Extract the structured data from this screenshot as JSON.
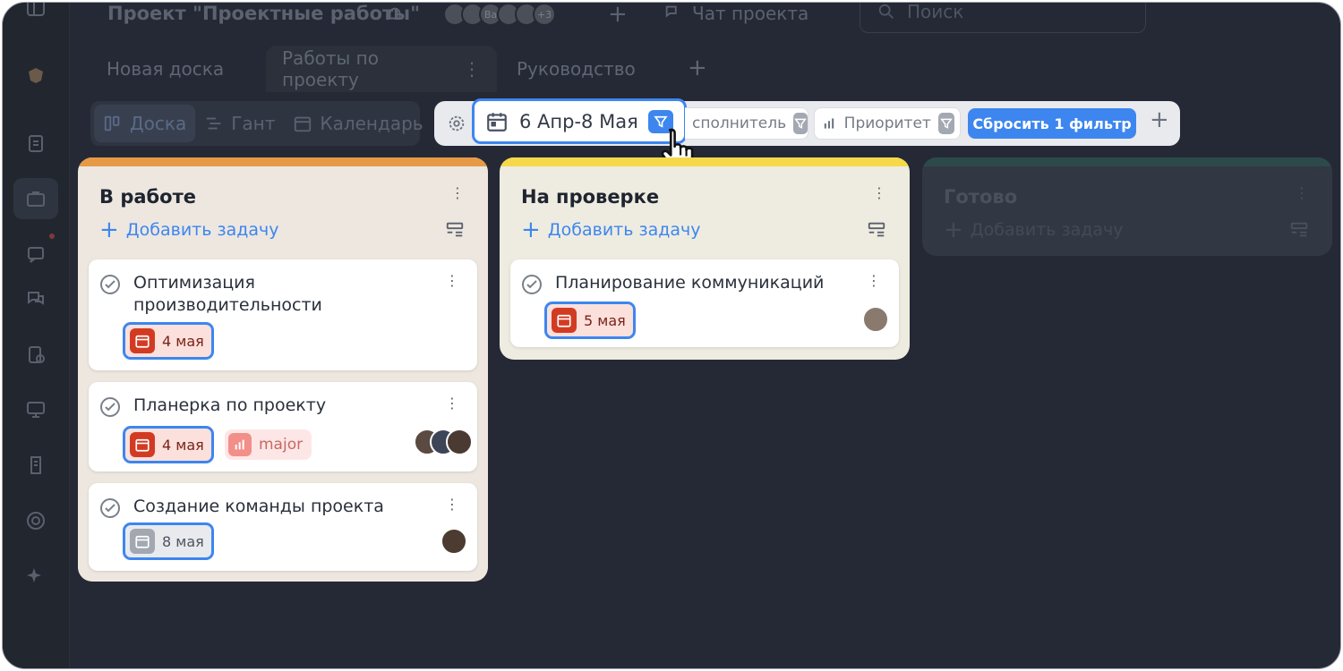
{
  "header": {
    "project_title": "Проект \"Проектные работы\"",
    "avatars_more": "+3",
    "avatar_initials": "Ва",
    "chat_label": "Чат проекта",
    "search_placeholder": "Поиск"
  },
  "tabs": [
    {
      "label": "Новая доска"
    },
    {
      "label": "Работы по проекту"
    },
    {
      "label": "Руководство"
    }
  ],
  "views": [
    {
      "label": "Доска",
      "icon": "board-icon"
    },
    {
      "label": "Гант",
      "icon": "gantt-icon"
    },
    {
      "label": "Календарь",
      "icon": "calendar-icon"
    }
  ],
  "filters": {
    "date_range": "6 Апр-8 Мая",
    "assignee_label": "сполнитель",
    "priority_label": "Приоритет",
    "reset_label": "Сбросить 1 фильтр"
  },
  "columns": [
    {
      "title": "В работе",
      "accent": "#e79a46",
      "bg": "#ede7e0",
      "add_label": "Добавить задачу",
      "cards": [
        {
          "title": "Оптимизация производительности",
          "due": "4 мая"
        },
        {
          "title": "Планерка по проекту",
          "due": "4 мая",
          "priority": "major"
        },
        {
          "title": "Создание команды проекта",
          "due": "8 мая"
        }
      ]
    },
    {
      "title": "На проверке",
      "accent": "#f6d94a",
      "bg": "#eeece0",
      "add_label": "Добавить задачу",
      "cards": [
        {
          "title": "Планирование коммуникаций",
          "due": "5 мая"
        }
      ]
    },
    {
      "title": "Готово",
      "accent": "#2d4a4a",
      "bg": "#323843",
      "add_label": "Добавить задачу",
      "cards": []
    }
  ],
  "colors": {
    "accent_blue": "#3d86ef",
    "overdue_red": "#d23b22",
    "background_dark": "#252935"
  }
}
